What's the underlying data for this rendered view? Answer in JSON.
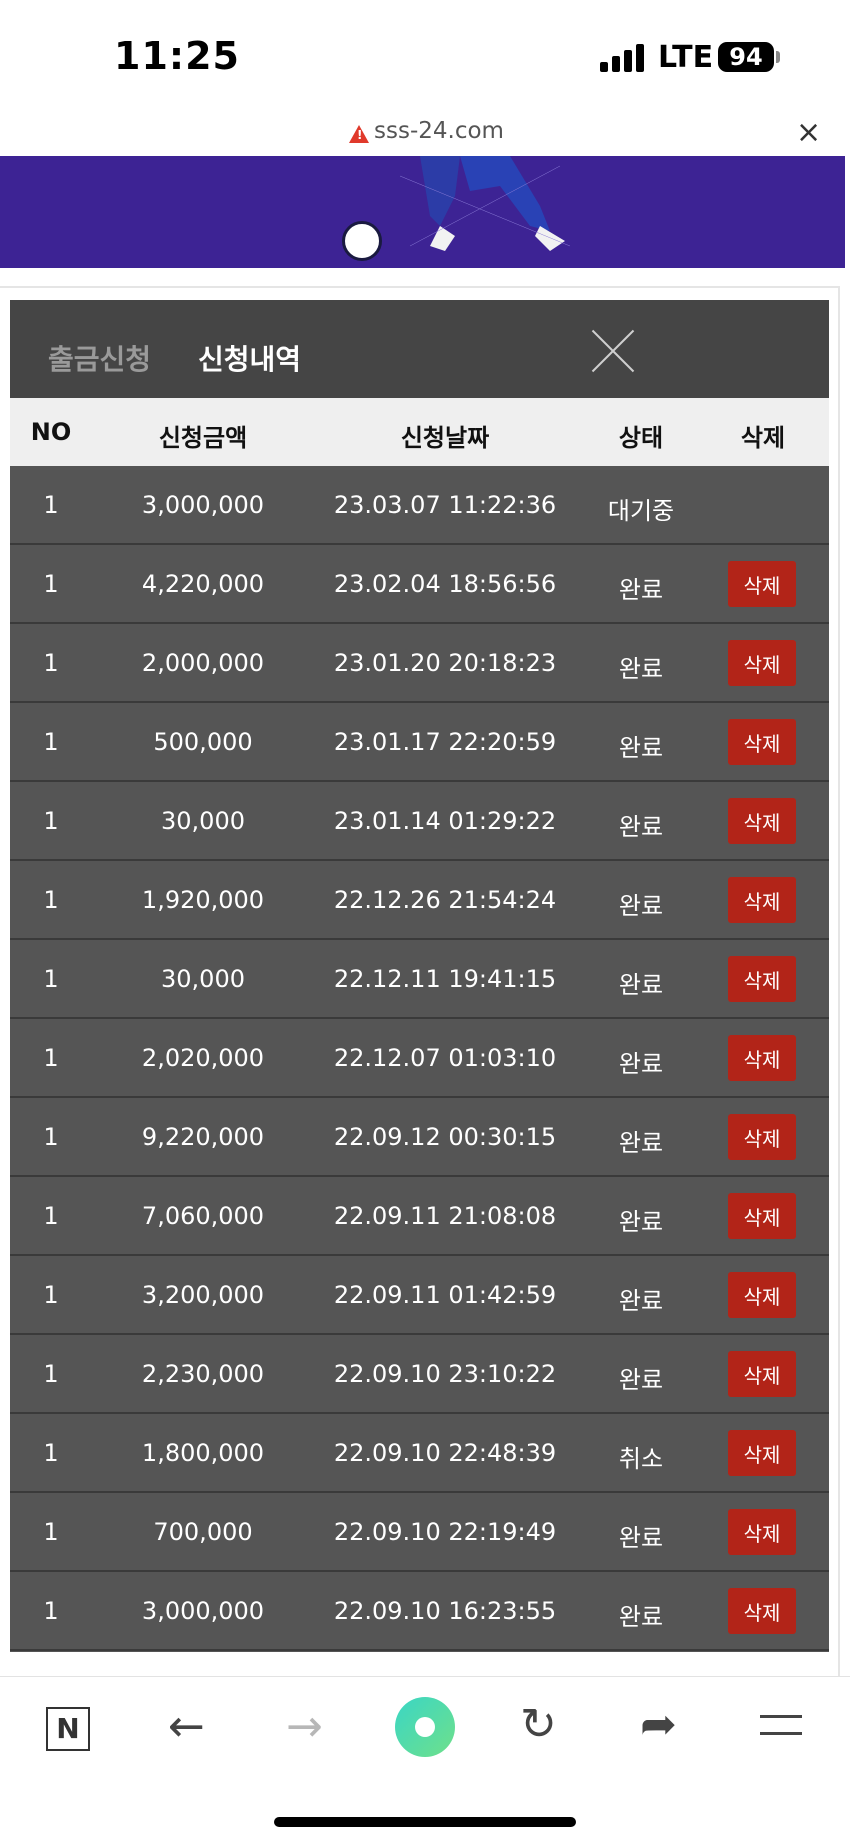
{
  "status_bar": {
    "time": "11:25",
    "network": "LTE",
    "battery": "94"
  },
  "browser": {
    "url": "sss-24.com",
    "close_symbol": "×"
  },
  "modal": {
    "tabs": [
      {
        "label": "출금신청",
        "active": false
      },
      {
        "label": "신청내역",
        "active": true
      }
    ],
    "columns": [
      "NO",
      "신청금액",
      "신청날짜",
      "상태",
      "삭제"
    ],
    "rows": [
      {
        "no": "1",
        "amount": "3,000,000",
        "date": "23.03.07 11:22:36",
        "state": "대기중",
        "delete": ""
      },
      {
        "no": "1",
        "amount": "4,220,000",
        "date": "23.02.04 18:56:56",
        "state": "완료",
        "delete": "삭제"
      },
      {
        "no": "1",
        "amount": "2,000,000",
        "date": "23.01.20 20:18:23",
        "state": "완료",
        "delete": "삭제"
      },
      {
        "no": "1",
        "amount": "500,000",
        "date": "23.01.17 22:20:59",
        "state": "완료",
        "delete": "삭제"
      },
      {
        "no": "1",
        "amount": "30,000",
        "date": "23.01.14 01:29:22",
        "state": "완료",
        "delete": "삭제"
      },
      {
        "no": "1",
        "amount": "1,920,000",
        "date": "22.12.26 21:54:24",
        "state": "완료",
        "delete": "삭제"
      },
      {
        "no": "1",
        "amount": "30,000",
        "date": "22.12.11 19:41:15",
        "state": "완료",
        "delete": "삭제"
      },
      {
        "no": "1",
        "amount": "2,020,000",
        "date": "22.12.07 01:03:10",
        "state": "완료",
        "delete": "삭제"
      },
      {
        "no": "1",
        "amount": "9,220,000",
        "date": "22.09.12 00:30:15",
        "state": "완료",
        "delete": "삭제"
      },
      {
        "no": "1",
        "amount": "7,060,000",
        "date": "22.09.11 21:08:08",
        "state": "완료",
        "delete": "삭제"
      },
      {
        "no": "1",
        "amount": "3,200,000",
        "date": "22.09.11 01:42:59",
        "state": "완료",
        "delete": "삭제"
      },
      {
        "no": "1",
        "amount": "2,230,000",
        "date": "22.09.10 23:10:22",
        "state": "완료",
        "delete": "삭제"
      },
      {
        "no": "1",
        "amount": "1,800,000",
        "date": "22.09.10 22:48:39",
        "state": "취소",
        "delete": "삭제"
      },
      {
        "no": "1",
        "amount": "700,000",
        "date": "22.09.10 22:19:49",
        "state": "완료",
        "delete": "삭제"
      },
      {
        "no": "1",
        "amount": "3,000,000",
        "date": "22.09.10 16:23:55",
        "state": "완료",
        "delete": "삭제"
      }
    ]
  },
  "bottom_nav": {
    "n_label": "N"
  },
  "colors": {
    "banner": "#3d2394",
    "delete_button": "#b22418",
    "modal_bg": "#555555",
    "header_bg": "#454545"
  }
}
